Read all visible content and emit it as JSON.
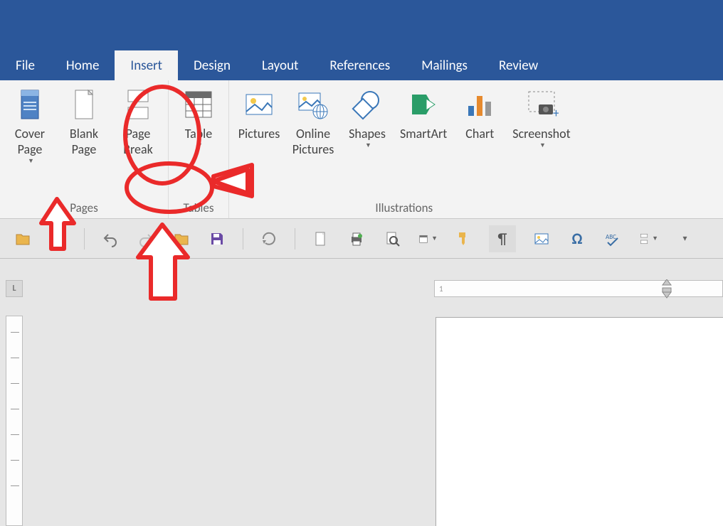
{
  "tabs": {
    "file": "File",
    "home": "Home",
    "insert": "Insert",
    "design": "Design",
    "layout": "Layout",
    "references": "References",
    "mailings": "Mailings",
    "review": "Review"
  },
  "active_tab": "insert",
  "ribbon": {
    "pages": {
      "label": "Pages",
      "cover_page": "Cover\nPage",
      "blank_page": "Blank\nPage",
      "page_break": "Page\nBreak"
    },
    "tables": {
      "label": "Tables",
      "table": "Table"
    },
    "illustrations": {
      "label": "Illustrations",
      "pictures": "Pictures",
      "online_pictures": "Online\nPictures",
      "shapes": "Shapes",
      "smartart": "SmartArt",
      "chart": "Chart",
      "screenshot": "Screenshot"
    }
  },
  "ruler": {
    "corner": "L",
    "h_start": "1"
  },
  "colors": {
    "brand": "#2B579A",
    "annotation": "#EA2A2A"
  }
}
